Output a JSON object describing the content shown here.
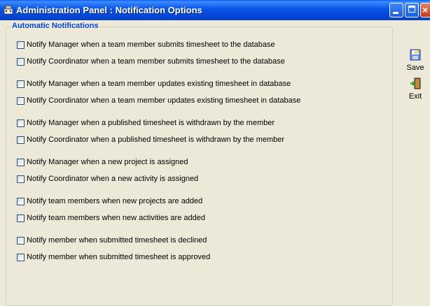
{
  "window": {
    "title": "Administration Panel : Notification Options",
    "close_symbol": "×"
  },
  "group": {
    "legend": "Automatic Notifications",
    "checkboxes": [
      {
        "label": "Notify Manager when a team member submits timesheet to the database",
        "checked": false
      },
      {
        "label": "Notify Coordinator when a team member submits timesheet to the database",
        "checked": false
      },
      {
        "label": "Notify Manager when a team member updates existing timesheet in database",
        "checked": false
      },
      {
        "label": "Notify Coordinator when a team member updates existing timesheet in database",
        "checked": false
      },
      {
        "label": "Notify Manager when a published timesheet is withdrawn by the member",
        "checked": false
      },
      {
        "label": "Notify Coordinator when a published timesheet is withdrawn by the member",
        "checked": false
      },
      {
        "label": "Notify Manager when a new project is assigned",
        "checked": false
      },
      {
        "label": "Notify Coordinator when a new activity is assigned",
        "checked": false
      },
      {
        "label": "Notify team members when new projects are added",
        "checked": false
      },
      {
        "label": "Notify team members when new activities are added",
        "checked": false
      },
      {
        "label": "Notify member when submitted timesheet is declined",
        "checked": false
      },
      {
        "label": "Notify member when submitted timesheet is approved",
        "checked": false
      }
    ]
  },
  "toolbar": {
    "save_label": "Save",
    "exit_label": "Exit"
  },
  "icons": {
    "app": "app-window-icon",
    "save": "save-disk-icon",
    "exit": "exit-door-icon"
  }
}
